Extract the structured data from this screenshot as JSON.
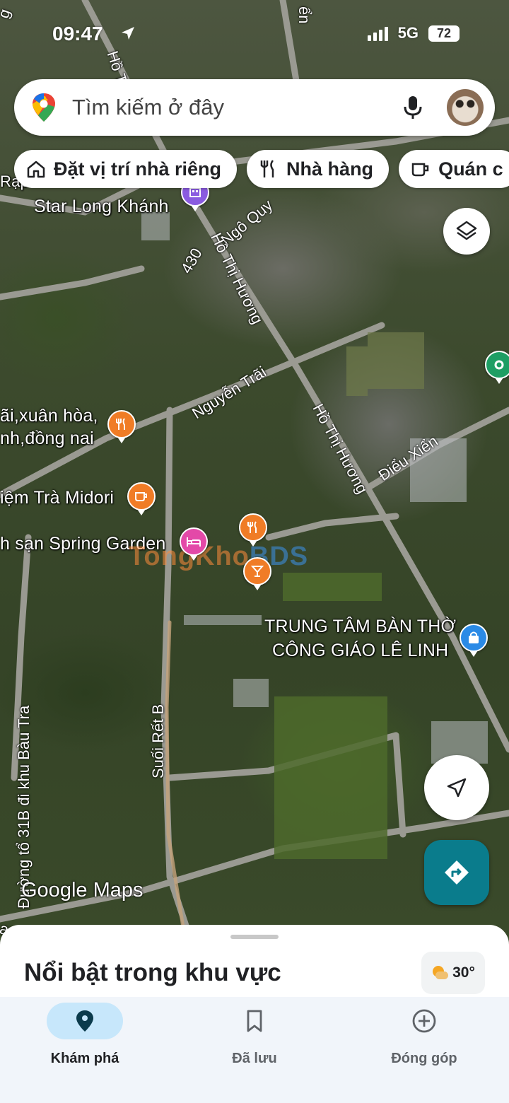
{
  "status_bar": {
    "time": "09:47",
    "network": "5G",
    "battery": "72"
  },
  "search": {
    "placeholder": "Tìm kiếm ở đây"
  },
  "chips": [
    {
      "label": "Đặt vị trí nhà riêng",
      "icon": "home-icon"
    },
    {
      "label": "Nhà hàng",
      "icon": "restaurant-icon"
    },
    {
      "label": "Quán c",
      "icon": "coffee-icon"
    }
  ],
  "map": {
    "places": {
      "rap": "Rạp",
      "star_long_khanh": "Star Long Khánh",
      "xuan_hoa_1": "ãi,xuân hòa,",
      "xuan_hoa_2": "nh,đồng nai",
      "tiem_tra": "iệm Trà Midori",
      "spring_garden": "h sạn Spring Garden",
      "trung_tam_1": "TRUNG TÂM BÀN THỜ",
      "trung_tam_2": "CÔNG GIÁO LÊ LINH"
    },
    "streets": {
      "ho_thi_huong_top": "Hồ Th",
      "road_430": "430",
      "ngo_quyen": "Ngô Quy",
      "ho_thi_huong_1": "Hồ Thị Hương",
      "nguyen_trai": "Nguyễn Trãi",
      "ho_thi_huong_2": "Hồ Thị Hương",
      "dieu_xien": "Điểu Xiển",
      "suoi_ret_b": "Suối Rết B",
      "duong_to_31b": "Đường tổ 31B đi khu Bàu Tra",
      "bau_tra": "au Tra",
      "top_en": "ển",
      "top_g": "g"
    },
    "watermark": {
      "part1": "TongKho",
      "part2": "BDS"
    },
    "attribution": "Google Maps"
  },
  "sheet": {
    "title": "Nổi bật trong khu vực",
    "temperature": "30°"
  },
  "nav": [
    {
      "label": "Khám phá",
      "icon": "explore-pin-icon",
      "active": true
    },
    {
      "label": "Đã lưu",
      "icon": "bookmark-icon",
      "active": false
    },
    {
      "label": "Đóng góp",
      "icon": "add-circle-icon",
      "active": false
    }
  ],
  "colors": {
    "accent_teal": "#0a7c8c",
    "nav_active": "#c7e7fb",
    "poi_orange": "#f07c26",
    "poi_pink": "#e349a8",
    "poi_blue": "#2a8ae6"
  }
}
